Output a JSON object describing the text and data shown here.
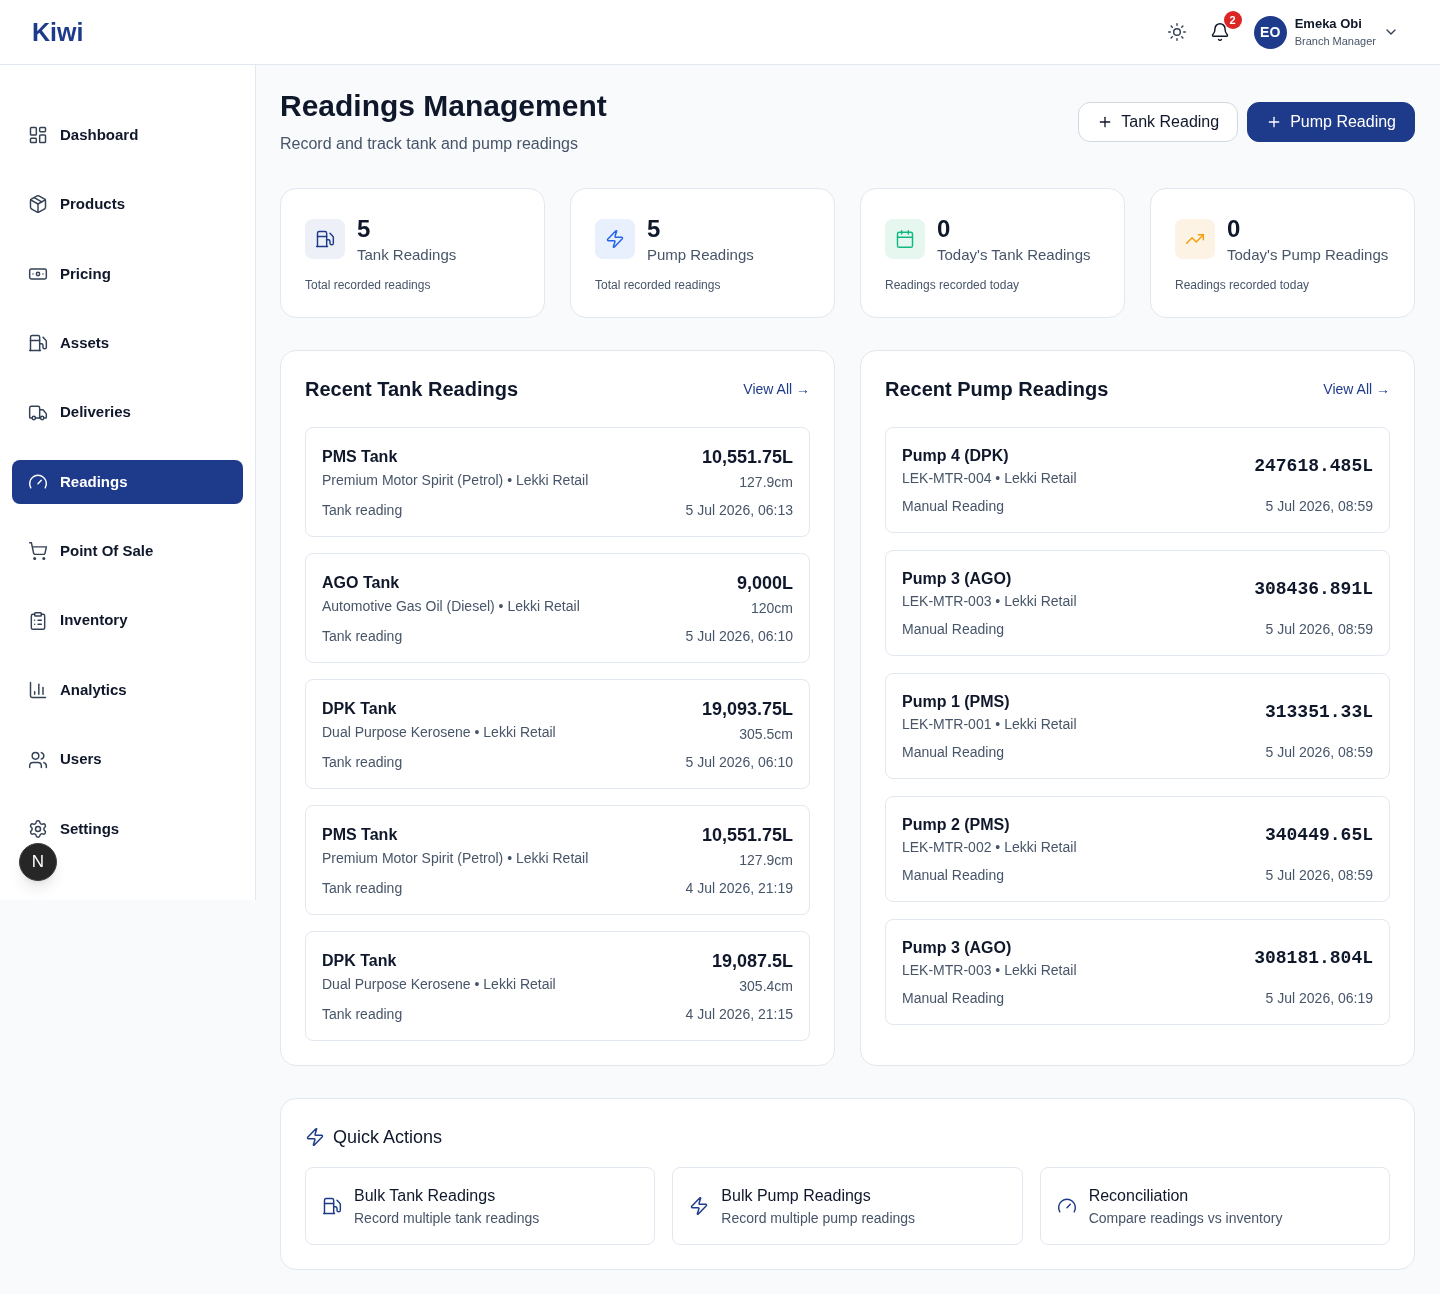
{
  "header": {
    "logo": "Kiwi",
    "notifications": {
      "count": "2"
    },
    "user": {
      "initials": "EO",
      "name": "Emeka Obi",
      "role": "Branch Manager"
    }
  },
  "sidebar": {
    "items": [
      {
        "label": "Dashboard",
        "selected": false
      },
      {
        "label": "Products",
        "selected": false
      },
      {
        "label": "Pricing",
        "selected": false
      },
      {
        "label": "Assets",
        "selected": false
      },
      {
        "label": "Deliveries",
        "selected": false
      },
      {
        "label": "Readings",
        "selected": true
      },
      {
        "label": "Point Of Sale",
        "selected": false
      },
      {
        "label": "Inventory",
        "selected": false
      },
      {
        "label": "Analytics",
        "selected": false
      },
      {
        "label": "Users",
        "selected": false
      },
      {
        "label": "Settings",
        "selected": false
      }
    ]
  },
  "dev_badge": {
    "label": "N"
  },
  "page": {
    "title": "Readings Management",
    "subtitle": "Record and track tank and pump readings",
    "actions": [
      {
        "label": "Tank Reading",
        "kind": "outline"
      },
      {
        "label": "Pump Reading",
        "kind": "primary"
      }
    ]
  },
  "stats": [
    {
      "value": "5",
      "label": "Tank Readings",
      "caption": "Total recorded readings"
    },
    {
      "value": "5",
      "label": "Pump Readings",
      "caption": "Total recorded readings"
    },
    {
      "value": "0",
      "label": "Today's Tank Readings",
      "caption": "Readings recorded today"
    },
    {
      "value": "0",
      "label": "Today's Pump Readings",
      "caption": "Readings recorded today"
    }
  ],
  "tank_readings": {
    "title": "Recent Tank Readings",
    "link": "View All →",
    "rows": [
      {
        "name": "PMS Tank",
        "details": "Premium Motor Spirit (Petrol) • Lekki Retail",
        "volume": "10,551.75L",
        "height": "127.9cm",
        "type": "Tank reading",
        "time": "5 Jul 2026, 06:13"
      },
      {
        "name": "AGO Tank",
        "details": "Automotive Gas Oil (Diesel) • Lekki Retail",
        "volume": "9,000L",
        "height": "120cm",
        "type": "Tank reading",
        "time": "5 Jul 2026, 06:10"
      },
      {
        "name": "DPK Tank",
        "details": "Dual Purpose Kerosene • Lekki Retail",
        "volume": "19,093.75L",
        "height": "305.5cm",
        "type": "Tank reading",
        "time": "5 Jul 2026, 06:10"
      },
      {
        "name": "PMS Tank",
        "details": "Premium Motor Spirit (Petrol) • Lekki Retail",
        "volume": "10,551.75L",
        "height": "127.9cm",
        "type": "Tank reading",
        "time": "4 Jul 2026, 21:19"
      },
      {
        "name": "DPK Tank",
        "details": "Dual Purpose Kerosene • Lekki Retail",
        "volume": "19,087.5L",
        "height": "305.4cm",
        "type": "Tank reading",
        "time": "4 Jul 2026, 21:15"
      }
    ]
  },
  "pump_readings": {
    "title": "Recent Pump Readings",
    "link": "View All →",
    "rows": [
      {
        "name": "Pump 4 (DPK)",
        "details": "LEK-MTR-004 • Lekki Retail",
        "reading": "247618.485L",
        "method": "Manual Reading",
        "time": "5 Jul 2026, 08:59"
      },
      {
        "name": "Pump 3 (AGO)",
        "details": "LEK-MTR-003 • Lekki Retail",
        "reading": "308436.891L",
        "method": "Manual Reading",
        "time": "5 Jul 2026, 08:59"
      },
      {
        "name": "Pump 1 (PMS)",
        "details": "LEK-MTR-001 • Lekki Retail",
        "reading": "313351.33L",
        "method": "Manual Reading",
        "time": "5 Jul 2026, 08:59"
      },
      {
        "name": "Pump 2 (PMS)",
        "details": "LEK-MTR-002 • Lekki Retail",
        "reading": "340449.65L",
        "method": "Manual Reading",
        "time": "5 Jul 2026, 08:59"
      },
      {
        "name": "Pump 3 (AGO)",
        "details": "LEK-MTR-003 • Lekki Retail",
        "reading": "308181.804L",
        "method": "Manual Reading",
        "time": "5 Jul 2026, 06:19"
      }
    ]
  },
  "quick_actions": {
    "title": "Quick Actions",
    "items": [
      {
        "title": "Bulk Tank Readings",
        "description": "Record multiple tank readings"
      },
      {
        "title": "Bulk Pump Readings",
        "description": "Record multiple pump readings"
      },
      {
        "title": "Reconciliation",
        "description": "Compare readings vs inventory"
      }
    ]
  }
}
